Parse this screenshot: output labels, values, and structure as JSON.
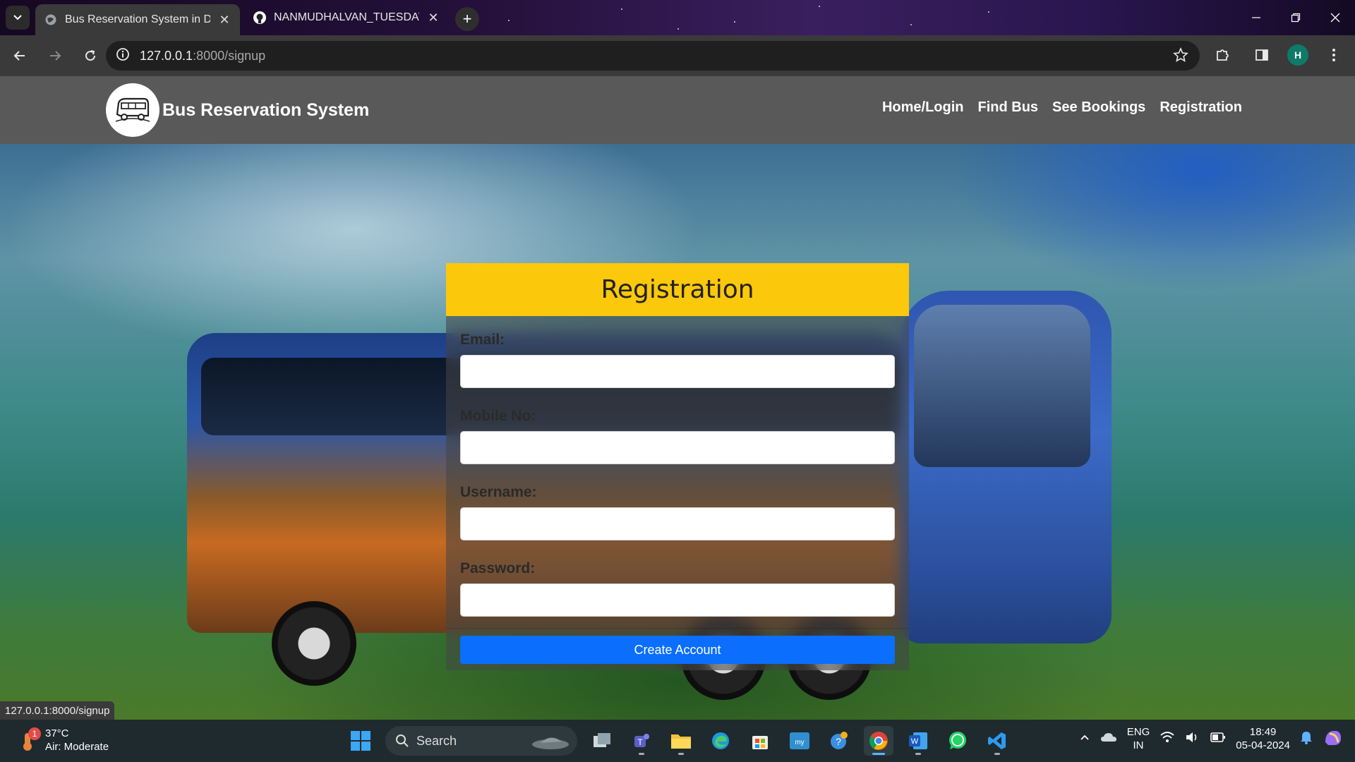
{
  "browser": {
    "tabs": [
      {
        "title": "Bus Reservation System in Djan",
        "active": true,
        "favicon": "globe-icon"
      },
      {
        "title": "NANMUDHALVAN_TUESDAYBA",
        "active": false,
        "favicon": "github-icon"
      }
    ],
    "url_host": "127.0.0.1",
    "url_path": ":8000/signup",
    "profile_initial": "H",
    "status_url": "127.0.0.1:8000/signup"
  },
  "site": {
    "brand": "Bus Reservation System",
    "nav": [
      {
        "label": "Home/Login"
      },
      {
        "label": "Find Bus"
      },
      {
        "label": "See Bookings"
      },
      {
        "label": "Registration"
      }
    ]
  },
  "form": {
    "title": "Registration",
    "fields": [
      {
        "label": "Email:",
        "value": ""
      },
      {
        "label": "Mobile No:",
        "value": ""
      },
      {
        "label": "Username:",
        "value": ""
      },
      {
        "label": "Password:",
        "value": ""
      }
    ],
    "submit_label": "Create Account"
  },
  "taskbar": {
    "weather_temp": "37°C",
    "weather_desc": "Air: Moderate",
    "weather_badge": "1",
    "search_label": "Search",
    "lang_line1": "ENG",
    "lang_line2": "IN",
    "time": "18:49",
    "date": "05-04-2024"
  },
  "colors": {
    "header_yellow": "#fcc80b",
    "button_blue": "#0b6efd",
    "navbar_gray": "#595959"
  }
}
